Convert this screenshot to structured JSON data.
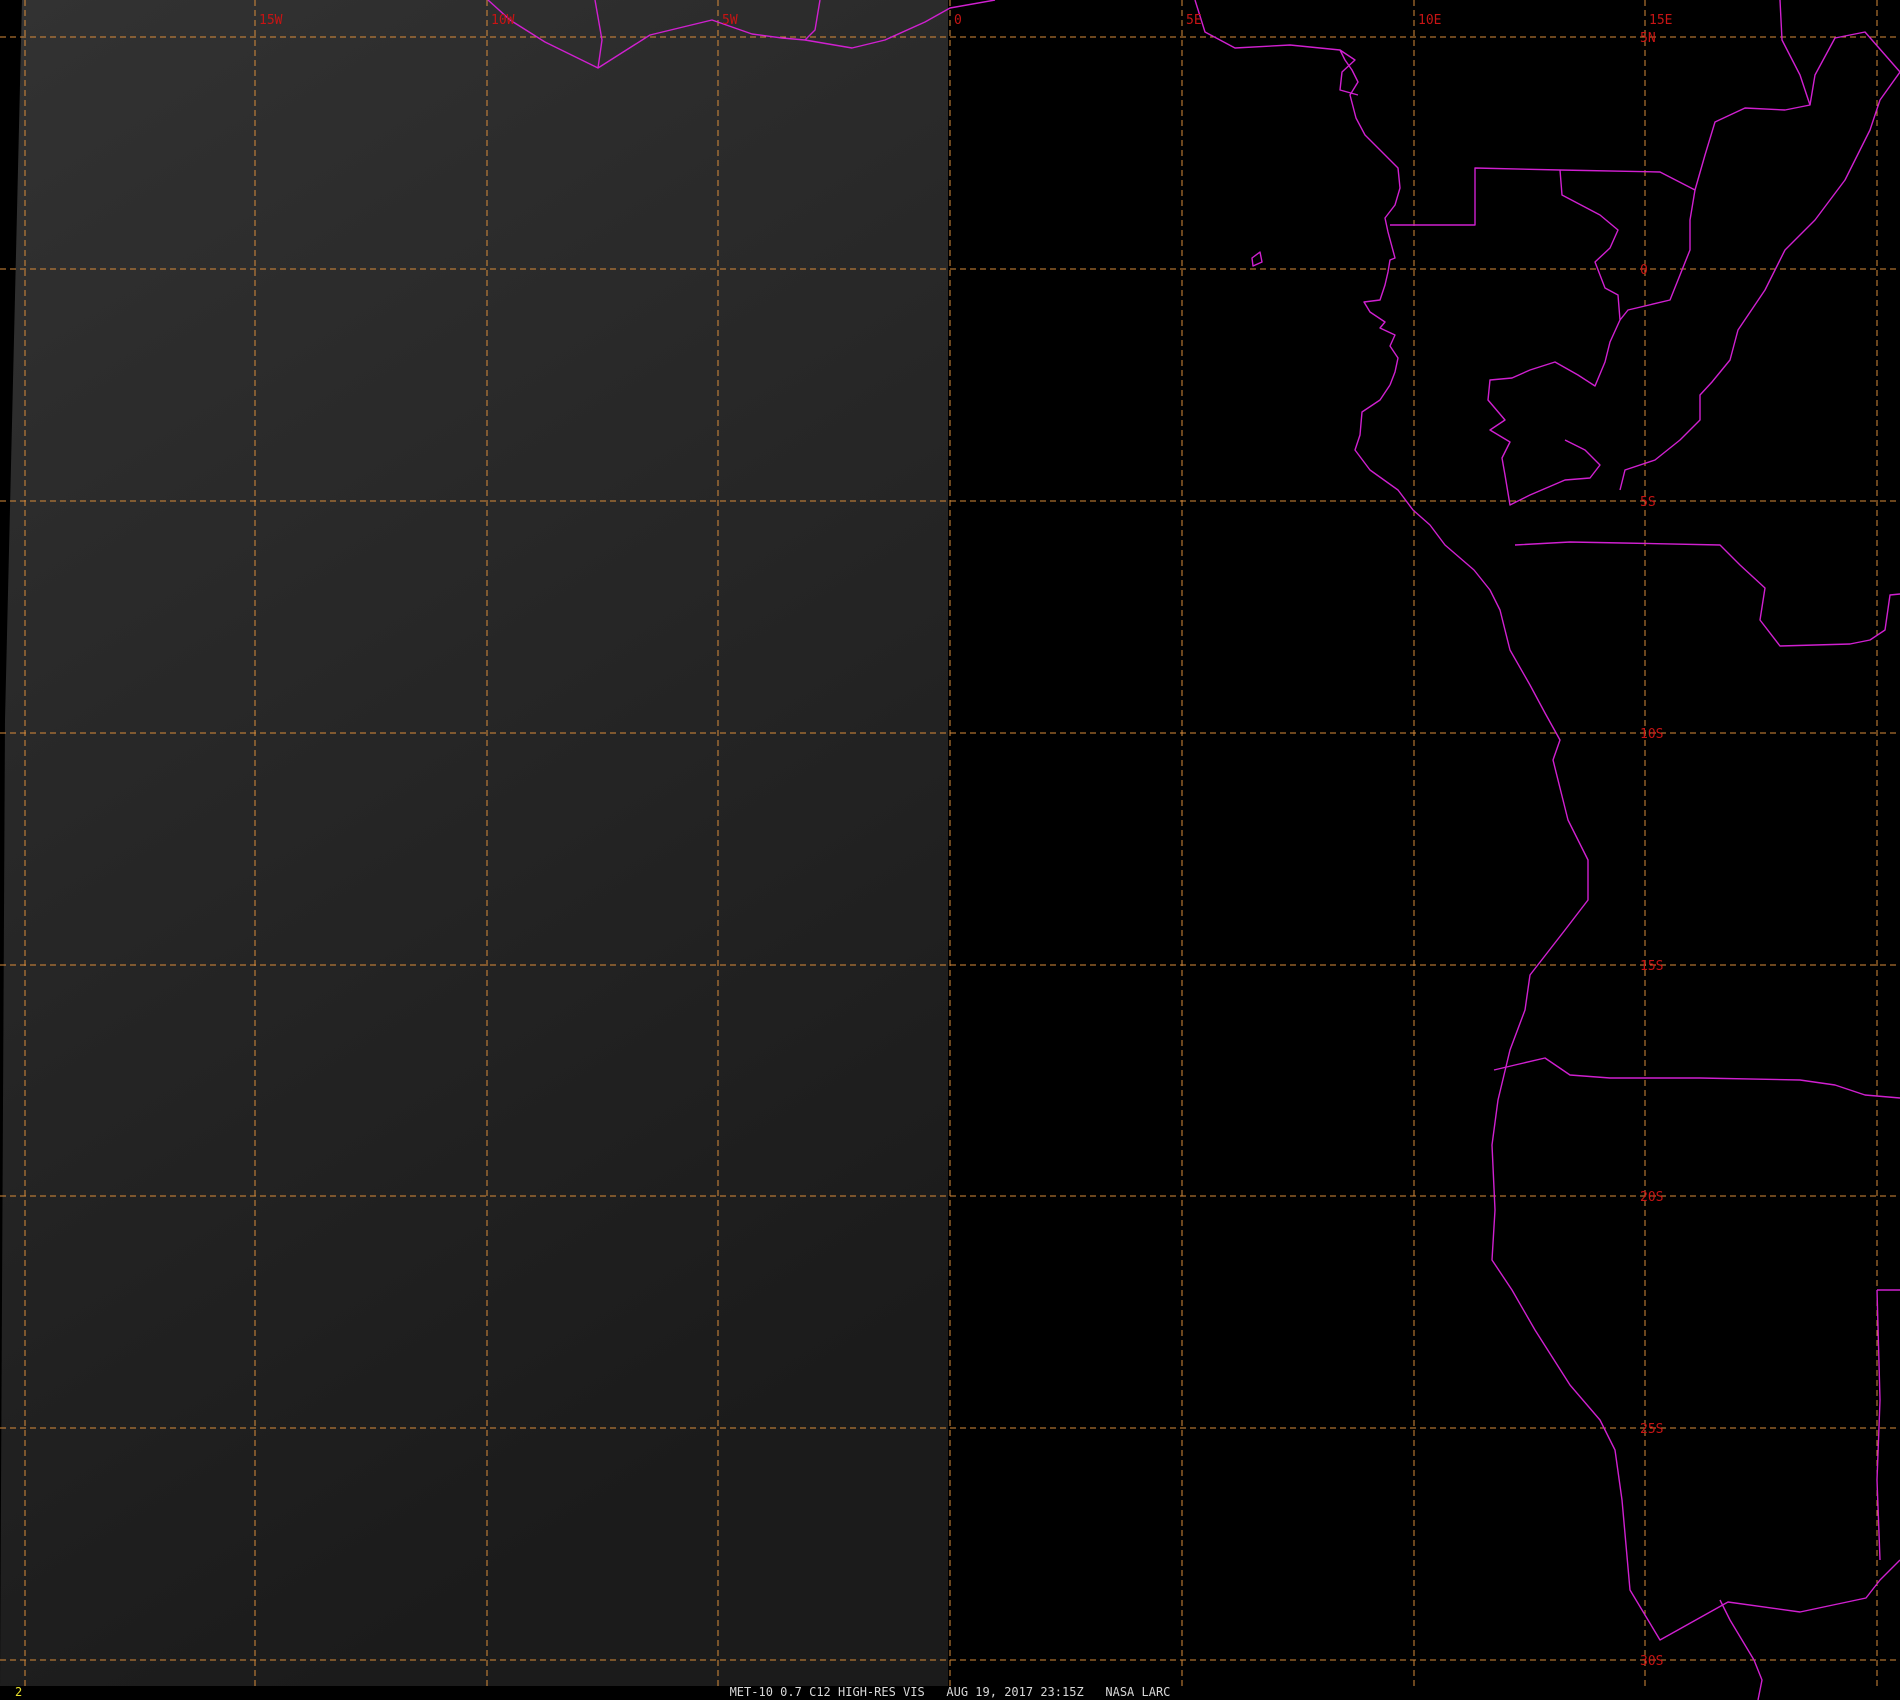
{
  "frame_number": "2",
  "caption": {
    "satellite": "MET-10",
    "channel": "0.7",
    "band": "C12",
    "product": "HIGH-RES VIS",
    "datetime": "AUG 19, 2017 23:15Z",
    "source": "NASA LARC"
  },
  "grid": {
    "longitude_labels": [
      "15W",
      "10W",
      "5W",
      "0",
      "5E",
      "10E",
      "15E"
    ],
    "latitude_labels": [
      "5N",
      "0",
      "5S",
      "10S",
      "15S",
      "20S",
      "25S",
      "30S"
    ]
  },
  "colors": {
    "background": "#000000",
    "shaded_region": "#262626",
    "grid_line": "#d98c3a",
    "grid_label": "#c81414",
    "boundary_line": "#d020d0",
    "frame_number": "#e8e02a",
    "caption": "#d8d8d8"
  }
}
